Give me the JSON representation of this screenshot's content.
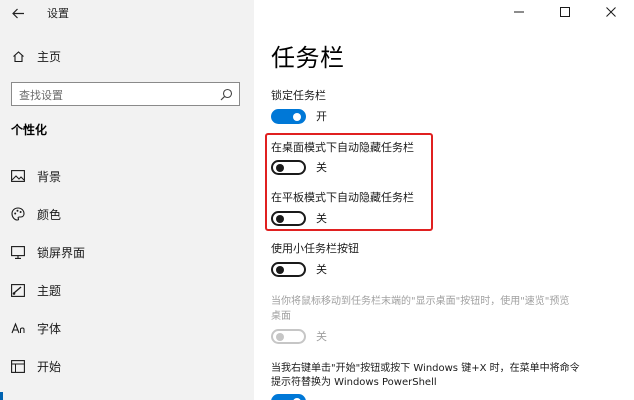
{
  "window": {
    "app_title": "设置"
  },
  "nav": {
    "home_label": "主页",
    "search_placeholder": "查找设置",
    "section_header": "个性化",
    "items": [
      {
        "label": "背景",
        "icon": "image-icon"
      },
      {
        "label": "颜色",
        "icon": "palette-icon"
      },
      {
        "label": "锁屏界面",
        "icon": "lock-screen-icon"
      },
      {
        "label": "主题",
        "icon": "theme-icon"
      },
      {
        "label": "字体",
        "icon": "font-icon"
      },
      {
        "label": "开始",
        "icon": "start-icon"
      }
    ]
  },
  "content": {
    "page_title": "任务栏",
    "settings": [
      {
        "label": "锁定任务栏",
        "state": "开",
        "on": true,
        "disabled": false
      },
      {
        "label": "在桌面模式下自动隐藏任务栏",
        "state": "关",
        "on": false,
        "disabled": false
      },
      {
        "label": "在平板模式下自动隐藏任务栏",
        "state": "关",
        "on": false,
        "disabled": false
      },
      {
        "label": "使用小任务栏按钮",
        "state": "关",
        "on": false,
        "disabled": false
      },
      {
        "label_line1": "当你将鼠标移动到任务栏末端的\"显示桌面\"按钮时，使用\"速览\"预览",
        "label_line2": "桌面",
        "state": "关",
        "on": false,
        "disabled": true
      },
      {
        "label_line1": "当我右键单击\"开始\"按钮或按下 Windows 键+X 时，在菜单中将命令",
        "label_line2": "提示符替换为 Windows PowerShell",
        "on": true,
        "disabled": false
      }
    ]
  },
  "colors": {
    "accent": "#0078d7",
    "highlight": "#e02020",
    "nav_background": "#f2f2f2"
  }
}
